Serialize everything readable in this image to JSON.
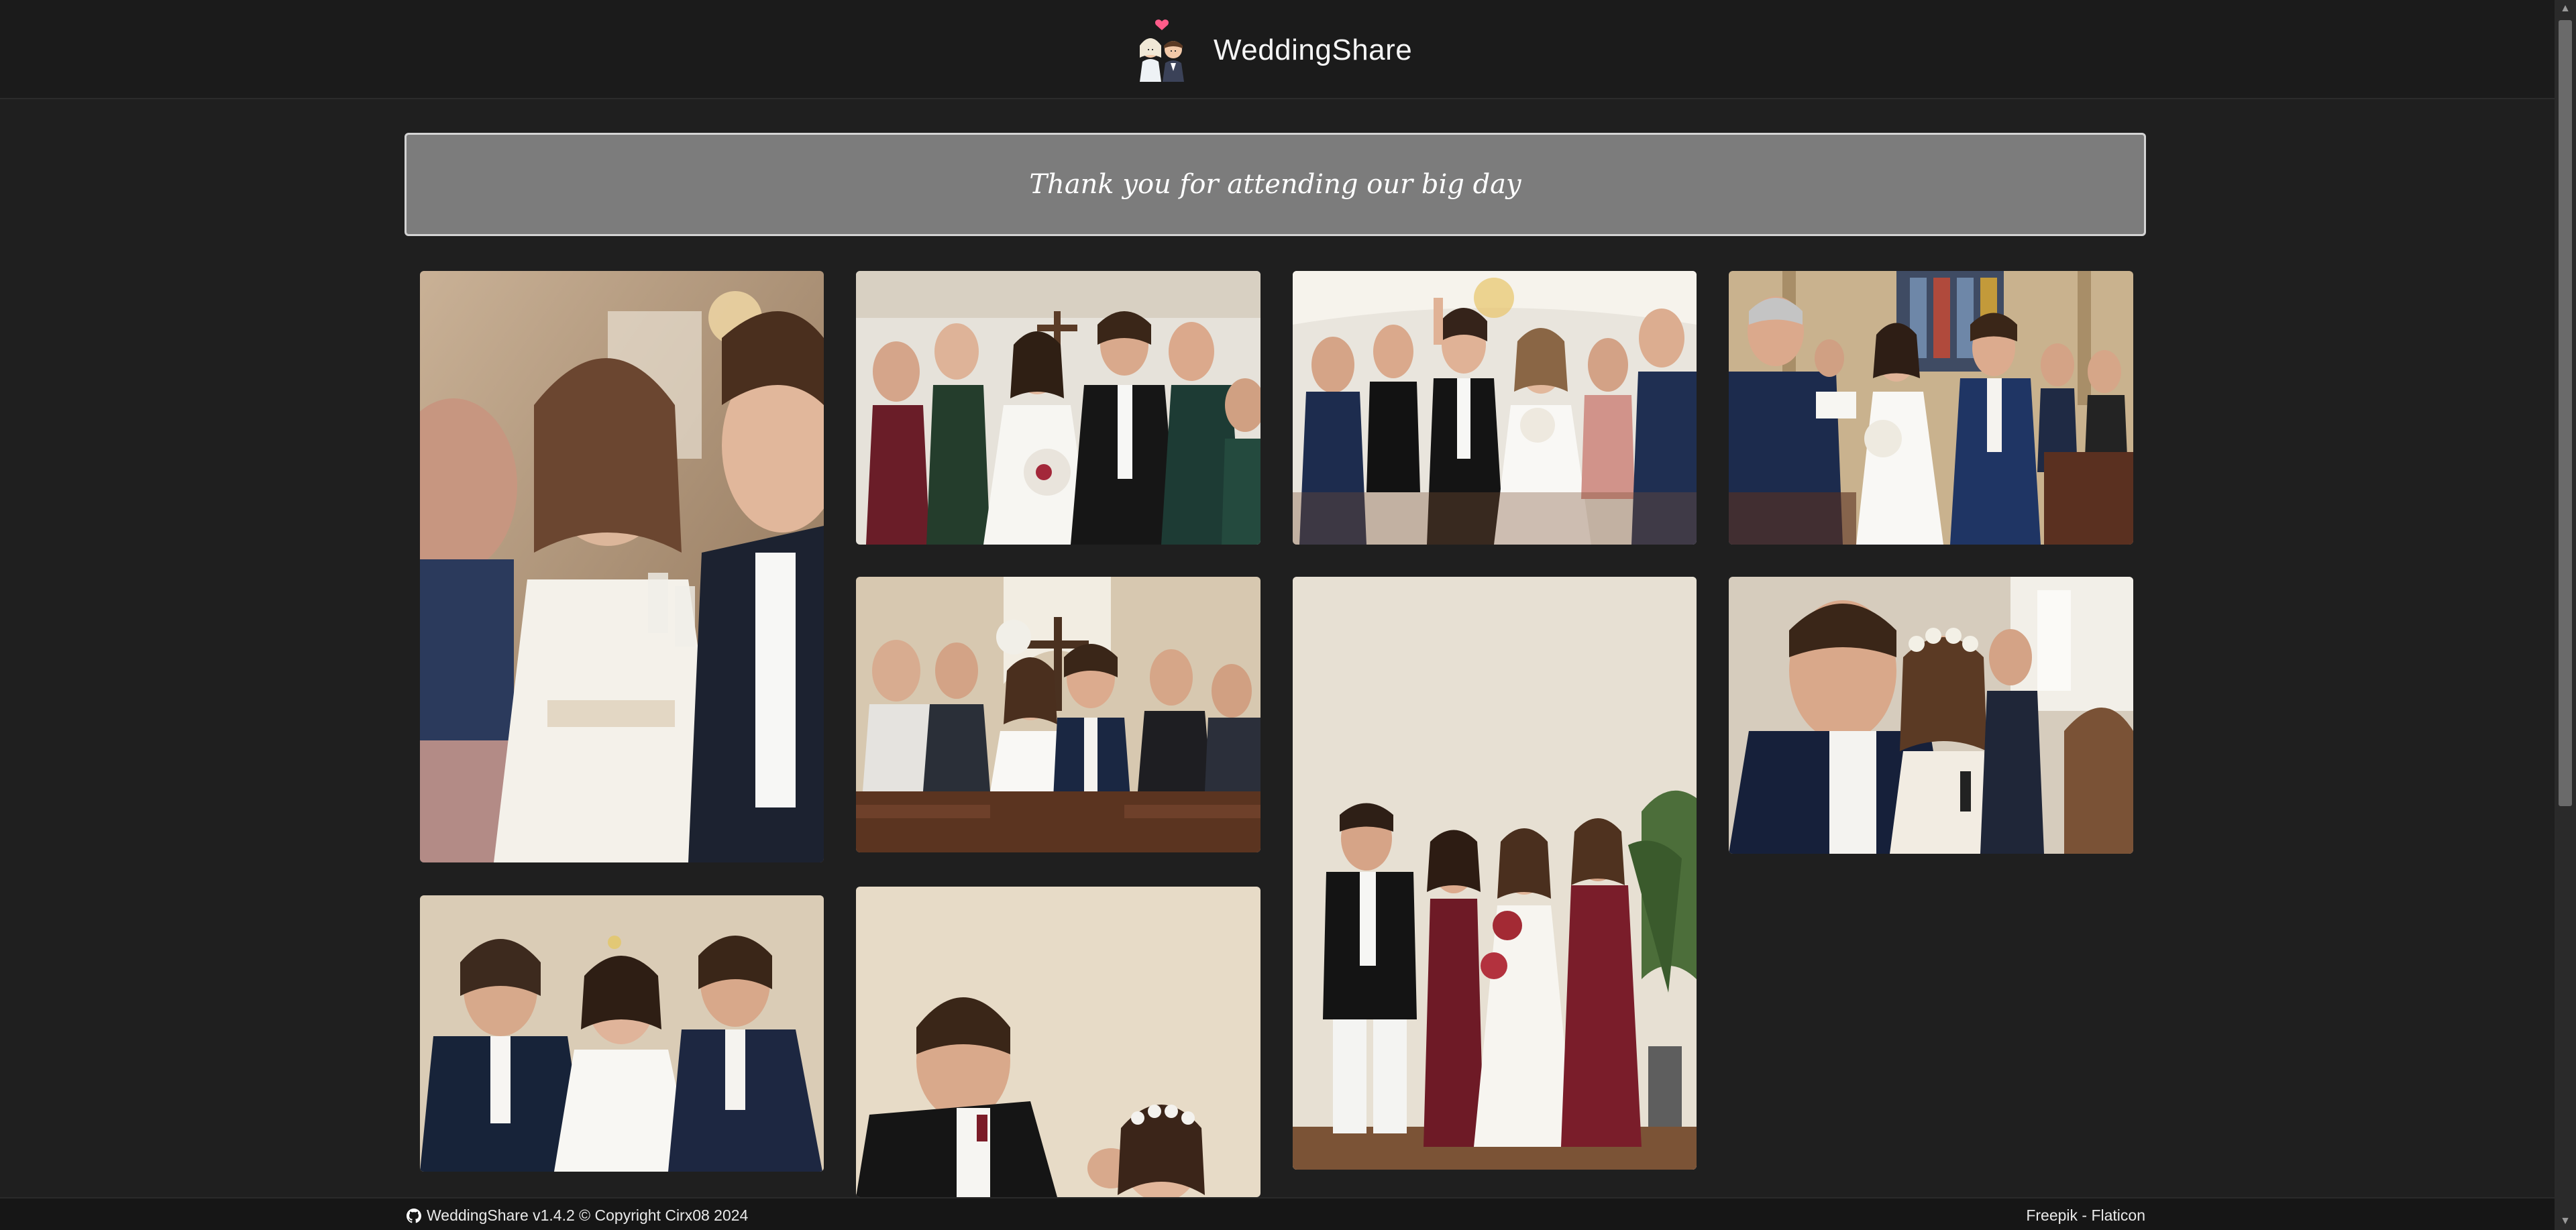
{
  "header": {
    "title": "WeddingShare",
    "logo_icon": "bride-groom-heart-icon"
  },
  "banner": {
    "text": "Thank you for attending our big day"
  },
  "gallery": {
    "photos": [
      {
        "subject": "bride toasting with guests"
      },
      {
        "subject": "couple walking out of ceremony with cheering guests"
      },
      {
        "subject": "groom raising arm in aisle with bride"
      },
      {
        "subject": "couple walking down church aisle"
      },
      {
        "subject": "couple walking under cross with cheering guests"
      },
      {
        "subject": "groom and bridesmaids standing by plant"
      },
      {
        "subject": "smiling groom and bride with flower crown"
      },
      {
        "subject": "groom clapping with bride and guest"
      },
      {
        "subject": "groom holding hand of bride"
      }
    ]
  },
  "footer": {
    "left_text": "WeddingShare v1.4.2 © Copyright Cirx08 2024",
    "right_text": "Freepik - Flaticon",
    "github_icon": "github-icon"
  },
  "colors": {
    "background": "#1f1f1f",
    "header": "#1b1b1b",
    "banner": "#7c7c7c",
    "banner_border": "#d4d4d4"
  }
}
